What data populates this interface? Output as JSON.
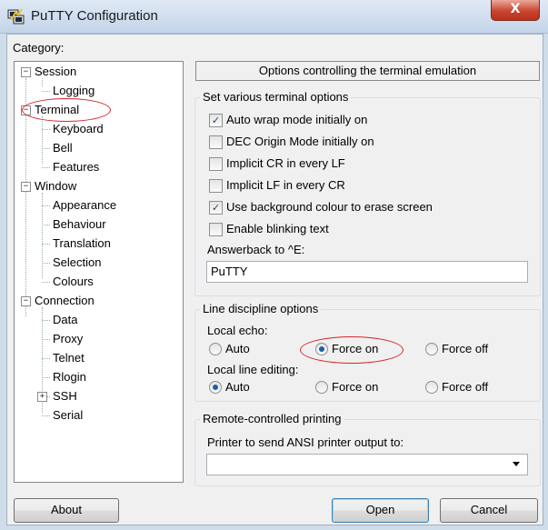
{
  "window": {
    "title": "PuTTY Configuration",
    "close_symbol": "X"
  },
  "category": {
    "label": "Category:",
    "tree": [
      {
        "label": "Session",
        "level": 0,
        "expander": "−"
      },
      {
        "label": "Logging",
        "level": 1
      },
      {
        "label": "Terminal",
        "level": 0,
        "expander": "−",
        "selected": true
      },
      {
        "label": "Keyboard",
        "level": 1
      },
      {
        "label": "Bell",
        "level": 1
      },
      {
        "label": "Features",
        "level": 1
      },
      {
        "label": "Window",
        "level": 0,
        "expander": "−"
      },
      {
        "label": "Appearance",
        "level": 1
      },
      {
        "label": "Behaviour",
        "level": 1
      },
      {
        "label": "Translation",
        "level": 1
      },
      {
        "label": "Selection",
        "level": 1
      },
      {
        "label": "Colours",
        "level": 1
      },
      {
        "label": "Connection",
        "level": 0,
        "expander": "−"
      },
      {
        "label": "Data",
        "level": 1
      },
      {
        "label": "Proxy",
        "level": 1
      },
      {
        "label": "Telnet",
        "level": 1
      },
      {
        "label": "Rlogin",
        "level": 1
      },
      {
        "label": "SSH",
        "level": 1,
        "expander": "+"
      },
      {
        "label": "Serial",
        "level": 1
      }
    ]
  },
  "panel": {
    "header": "Options controlling the terminal emulation",
    "terminal_options": {
      "title": "Set various terminal options",
      "checkboxes": [
        {
          "label": "Auto wrap mode initially on",
          "checked": true
        },
        {
          "label": "DEC Origin Mode initially on",
          "checked": false
        },
        {
          "label": "Implicit CR in every LF",
          "checked": false
        },
        {
          "label": "Implicit LF in every CR",
          "checked": false
        },
        {
          "label": "Use background colour to erase screen",
          "checked": true
        },
        {
          "label": "Enable blinking text",
          "checked": false
        }
      ],
      "answerback_label": "Answerback to ^E:",
      "answerback_value": "PuTTY"
    },
    "line_discipline": {
      "title": "Line discipline options",
      "local_echo": {
        "label": "Local echo:",
        "options": [
          "Auto",
          "Force on",
          "Force off"
        ],
        "selected": "Force on"
      },
      "local_line_editing": {
        "label": "Local line editing:",
        "options": [
          "Auto",
          "Force on",
          "Force off"
        ],
        "selected": "Auto"
      }
    },
    "printing": {
      "title": "Remote-controlled printing",
      "printer_label": "Printer to send ANSI printer output to:",
      "printer_value": ""
    }
  },
  "buttons": {
    "about": "About",
    "open": "Open",
    "cancel": "Cancel"
  },
  "colors": {
    "annotation_red": "#d2252a",
    "check_blue": "#21456f"
  }
}
